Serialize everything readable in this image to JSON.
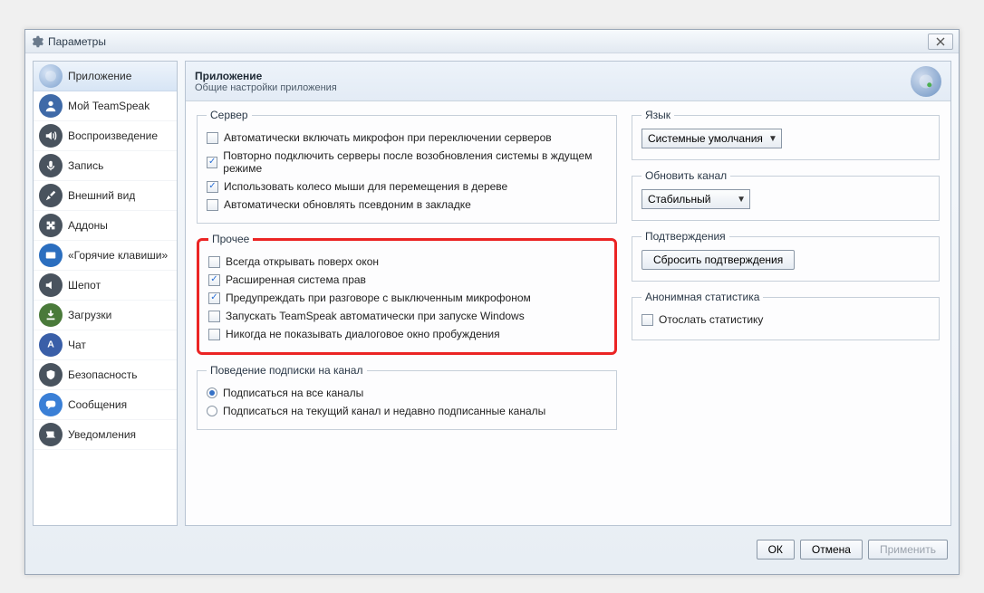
{
  "window": {
    "title": "Параметры"
  },
  "sidebar": {
    "items": [
      {
        "label": "Приложение"
      },
      {
        "label": "Мой TeamSpeak"
      },
      {
        "label": "Воспроизведение"
      },
      {
        "label": "Запись"
      },
      {
        "label": "Внешний вид"
      },
      {
        "label": "Аддоны"
      },
      {
        "label": "«Горячие клавиши»"
      },
      {
        "label": "Шепот"
      },
      {
        "label": "Загрузки"
      },
      {
        "label": "Чат"
      },
      {
        "label": "Безопасность"
      },
      {
        "label": "Сообщения"
      },
      {
        "label": "Уведомления"
      }
    ]
  },
  "content": {
    "title": "Приложение",
    "subtitle": "Общие настройки приложения",
    "server_group": "Сервер",
    "server_opts": [
      {
        "label": "Автоматически включать микрофон при переключении серверов",
        "checked": false
      },
      {
        "label": "Повторно подключить серверы после возобновления системы в ждущем режиме",
        "checked": true
      },
      {
        "label": "Использовать колесо мыши для перемещения в дереве",
        "checked": true
      },
      {
        "label": "Автоматически обновлять псевдоним в закладке",
        "checked": false
      }
    ],
    "misc_group": "Прочее",
    "misc_opts": [
      {
        "label": "Всегда открывать поверх окон",
        "checked": false
      },
      {
        "label": "Расширенная система прав",
        "checked": true
      },
      {
        "label": "Предупреждать при разговоре с выключенным микрофоном",
        "checked": true
      },
      {
        "label": "Запускать TeamSpeak автоматически при запуске Windows",
        "checked": false
      },
      {
        "label": "Никогда не показывать диалоговое окно пробуждения",
        "checked": false
      }
    ],
    "subscribe_group": "Поведение подписки на канал",
    "subscribe_opts": [
      {
        "label": "Подписаться на все каналы",
        "selected": true
      },
      {
        "label": "Подписаться на текущий канал и недавно подписанные каналы",
        "selected": false
      }
    ],
    "language_group": "Язык",
    "language_value": "Системные умолчания",
    "update_group": "Обновить канал",
    "update_value": "Стабильный",
    "confirm_group": "Подтверждения",
    "confirm_button": "Сбросить подтверждения",
    "stats_group": "Анонимная статистика",
    "stats_opt_label": "Отослать статистику",
    "stats_opt_checked": false
  },
  "footer": {
    "ok": "ОК",
    "cancel": "Отмена",
    "apply": "Применить"
  }
}
